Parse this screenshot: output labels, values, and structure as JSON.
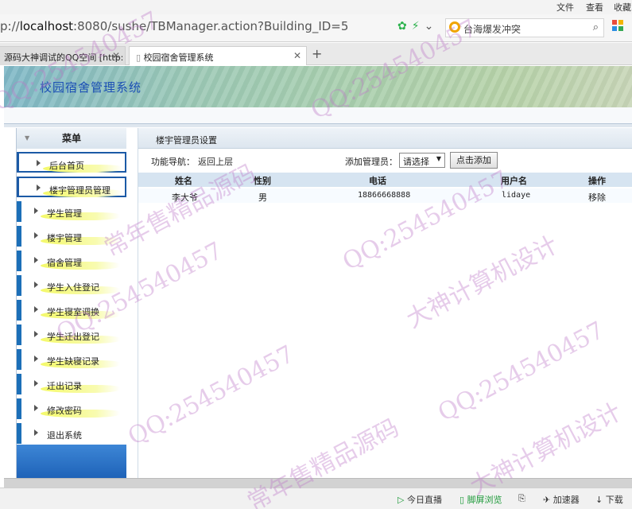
{
  "browser": {
    "menu": [
      "文件",
      "查看",
      "收藏"
    ],
    "url_prefix": "p://",
    "url_host": "localhost",
    "url_rest": ":8080/sushe/TBManager.action?Building_ID=5",
    "search_text": "台海爆发冲突",
    "tabs": [
      {
        "label": "源码大神调试的QQ空间 [http:"
      },
      {
        "label": "校园宿舍管理系统"
      }
    ],
    "newtab_label": "+"
  },
  "app": {
    "title": "校园宿舍管理系统"
  },
  "sidebar": {
    "header": "菜单",
    "items": [
      {
        "label": "后台首页"
      },
      {
        "label": "楼宇管理员管理"
      },
      {
        "label": "学生管理"
      },
      {
        "label": "楼宇管理"
      },
      {
        "label": "宿舍管理"
      },
      {
        "label": "学生入住登记"
      },
      {
        "label": "学生寝室调换"
      },
      {
        "label": "学生迁出登记"
      },
      {
        "label": "学生缺寝记录"
      },
      {
        "label": "迁出记录"
      },
      {
        "label": "修改密码"
      },
      {
        "label": "退出系统"
      }
    ]
  },
  "main": {
    "heading": "楼宇管理员设置",
    "nav_label": "功能导航：",
    "back_link": "返回上层",
    "add_label": "添加管理员：",
    "select_value": "请选择",
    "add_button": "点击添加",
    "columns": [
      "姓名",
      "性别",
      "电话",
      "用户名",
      "操作"
    ],
    "rows": [
      {
        "name": "李大爷",
        "gender": "男",
        "phone": "18866668888",
        "username": "lidaye",
        "action": "移除"
      }
    ]
  },
  "statusbar": {
    "items": [
      "今日直播",
      "脚屏浏览",
      "加速器",
      "下载"
    ]
  },
  "watermark": {
    "qq": "QQ:254540457",
    "text1": "大神计算机设计",
    "text2": "常年售精品源码"
  }
}
